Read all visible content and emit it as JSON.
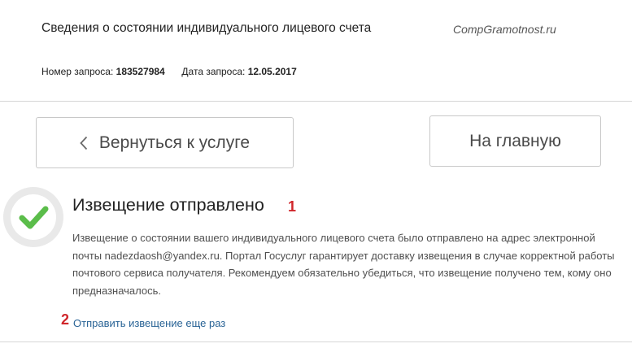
{
  "header": {
    "title": "Сведения о состоянии индивидуального лицевого счета",
    "watermark": "CompGramotnost.ru"
  },
  "request": {
    "number_label": "Номер запроса:",
    "number_value": "183527984",
    "date_label": "Дата запроса:",
    "date_value": "12.05.2017"
  },
  "buttons": {
    "back_label": "Вернуться к услуге",
    "home_label": "На главную"
  },
  "notice": {
    "icon": "checkmark-icon",
    "title": "Извещение отправлено",
    "marker": "1",
    "body": "Извещение о состоянии вашего индивидуального лицевого счета было отправлено на адрес электронной почты nadezdaosh@yandex.ru. Портал Госуслуг гарантирует доставку извещения в случае корректной работы почтового сервиса получателя. Рекомендуем обязательно убедиться, что извещение получено тем, кому оно предназначалось."
  },
  "resend": {
    "marker": "2",
    "link_label": "Отправить извещение еще раз"
  },
  "colors": {
    "check_green": "#5bbd4a",
    "link_blue": "#2a6496",
    "marker_red": "#d0262b"
  }
}
